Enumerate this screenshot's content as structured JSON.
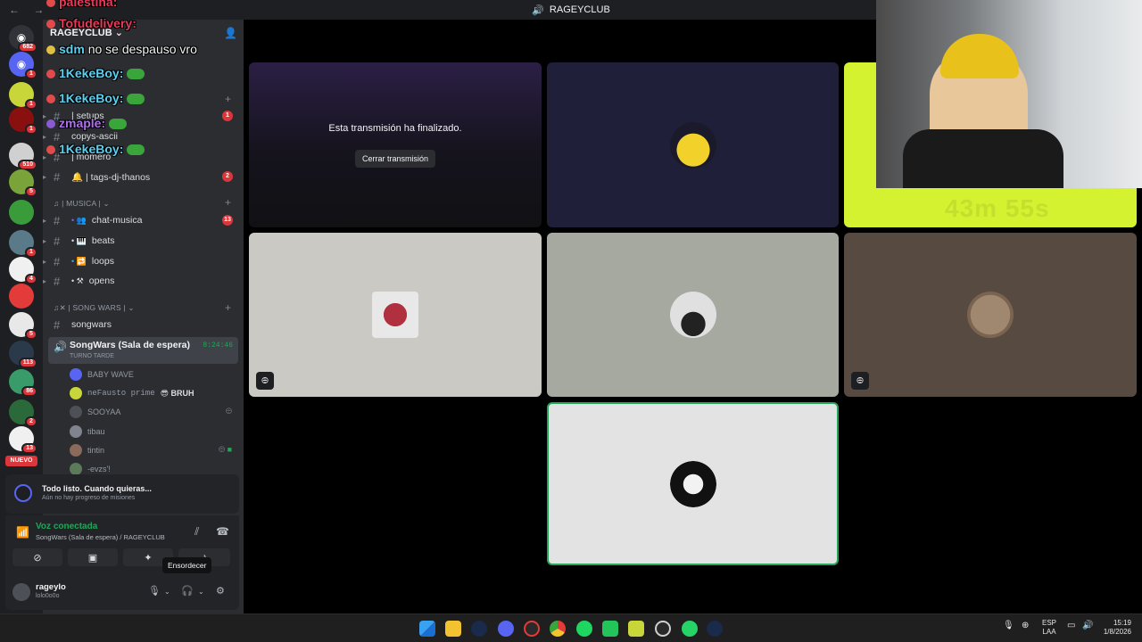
{
  "window": {
    "title": "RAGEYCLUB",
    "nav_arrows": "← →"
  },
  "server_rail": {
    "servers": [
      {
        "name": "home",
        "color": "#313338",
        "badge": "682",
        "glyph": "◉"
      },
      {
        "name": "discord",
        "color": "#5865f2",
        "badge": "1",
        "glyph": "◉"
      },
      {
        "name": "server-3",
        "color": "#c8d63a",
        "badge": "1",
        "glyph": ""
      },
      {
        "name": "server-4",
        "color": "#8a1010",
        "badge": "1",
        "glyph": ""
      },
      {
        "name": "server-5",
        "color": "#d0d0d0",
        "badge": "510",
        "glyph": ""
      },
      {
        "name": "server-6",
        "color": "#7aa33a",
        "badge": "5",
        "glyph": ""
      },
      {
        "name": "server-7",
        "color": "#3a9b3a",
        "badge": "",
        "glyph": ""
      },
      {
        "name": "server-8",
        "color": "#5a7a8a",
        "badge": "1",
        "glyph": ""
      },
      {
        "name": "stereo",
        "color": "#f0f0f0",
        "badge": "4",
        "glyph": ""
      },
      {
        "name": "server-10",
        "color": "#e33a3a",
        "badge": "",
        "glyph": ""
      },
      {
        "name": "server-11",
        "color": "#e8e8e8",
        "badge": "5",
        "glyph": ""
      },
      {
        "name": "server-12",
        "color": "#2a3a4a",
        "badge": "113",
        "glyph": ""
      },
      {
        "name": "server-13",
        "color": "#3a9b6a",
        "badge": "86",
        "glyph": ""
      },
      {
        "name": "server-14",
        "color": "#2a6a3a",
        "badge": "2",
        "glyph": ""
      },
      {
        "name": "server-15",
        "color": "#f0f0f0",
        "badge": "13",
        "glyph": ""
      }
    ],
    "nuevo_label": "NUEVO"
  },
  "sidebar": {
    "guild_name": "RAGEYCLUB",
    "guild_chevron": "⌄",
    "channels_top": [
      {
        "label": "| setups",
        "mention": "1"
      },
      {
        "label": "copys-ascii",
        "mention": ""
      },
      {
        "label": "| momero",
        "mention": ""
      },
      {
        "label": "🔔 | tags-dj-thanos",
        "mention": "2"
      }
    ],
    "category_musica": "| MUSICA |",
    "musica_channels": [
      {
        "label": "chat-musica",
        "mention": "13"
      },
      {
        "label": "beats",
        "mention": ""
      },
      {
        "label": "loops",
        "mention": ""
      },
      {
        "label": "opens",
        "mention": ""
      }
    ],
    "category_songwars": "| SONG WARS |",
    "songwars_text": "songwars",
    "voice_channel": {
      "name": "SongWars (Sala de espera)",
      "time": "8:24:46",
      "sub": "TURNO TARDE"
    },
    "voice_users": [
      {
        "name": "BABY WAVE",
        "extra": "",
        "color": "#5865f2"
      },
      {
        "name": "neFausto prime",
        "extra": "😎 BRUH",
        "color": "#c8d63a"
      },
      {
        "name": "SOOYAA",
        "extra": "",
        "color": "#4e5058"
      },
      {
        "name": "tibau",
        "extra": "",
        "color": "#80848e"
      },
      {
        "name": "tintin",
        "extra": "",
        "color": "#8a6a5a"
      },
      {
        "name": "-evzs'!",
        "extra": "",
        "color": "#5a7a5a"
      }
    ]
  },
  "chat_overlay": [
    {
      "user": "palestina:",
      "text": "",
      "color": "#e83a5a"
    },
    {
      "user": "Tofudelivery:",
      "text": "",
      "color": "#e83a5a"
    },
    {
      "user": "sdm",
      "text": "no se despauso vro",
      "color": "#5ad0f0"
    },
    {
      "user": "1KekeBoy:",
      "text": "",
      "color": "#5ad0f0"
    },
    {
      "user": "1KekeBoy:",
      "text": "",
      "color": "#5ad0f0"
    },
    {
      "user": "zmaple:",
      "text": "",
      "color": "#b070f0"
    },
    {
      "user": "1KekeBoy:",
      "text": "",
      "color": "#5ad0f0"
    }
  ],
  "mission": {
    "title": "Todo listo. Cuando quieras...",
    "subtitle": "Aún no hay progreso de misiones"
  },
  "voice_status": {
    "title": "Voz conectada",
    "subtitle": "SongWars (Sala de espera) / RAGEYCLUB"
  },
  "tooltip": "Ensordecer",
  "user_panel": {
    "name": "rageylo",
    "tag": "lolo0o0o"
  },
  "stage": {
    "ended_message": "Esta transmisión ha finalizado.",
    "close_stream_button": "Cerrar transmisión"
  },
  "webcam": {
    "timer": "43m 55s"
  },
  "taskbar": {
    "lang_top": "ESP",
    "lang_bottom": "LAA",
    "time": "15:19",
    "date": "1/8/2026"
  },
  "colors": {
    "accent": "#5865f2",
    "online": "#23a55a",
    "danger": "#da373c",
    "highlight": "#d4f230"
  }
}
